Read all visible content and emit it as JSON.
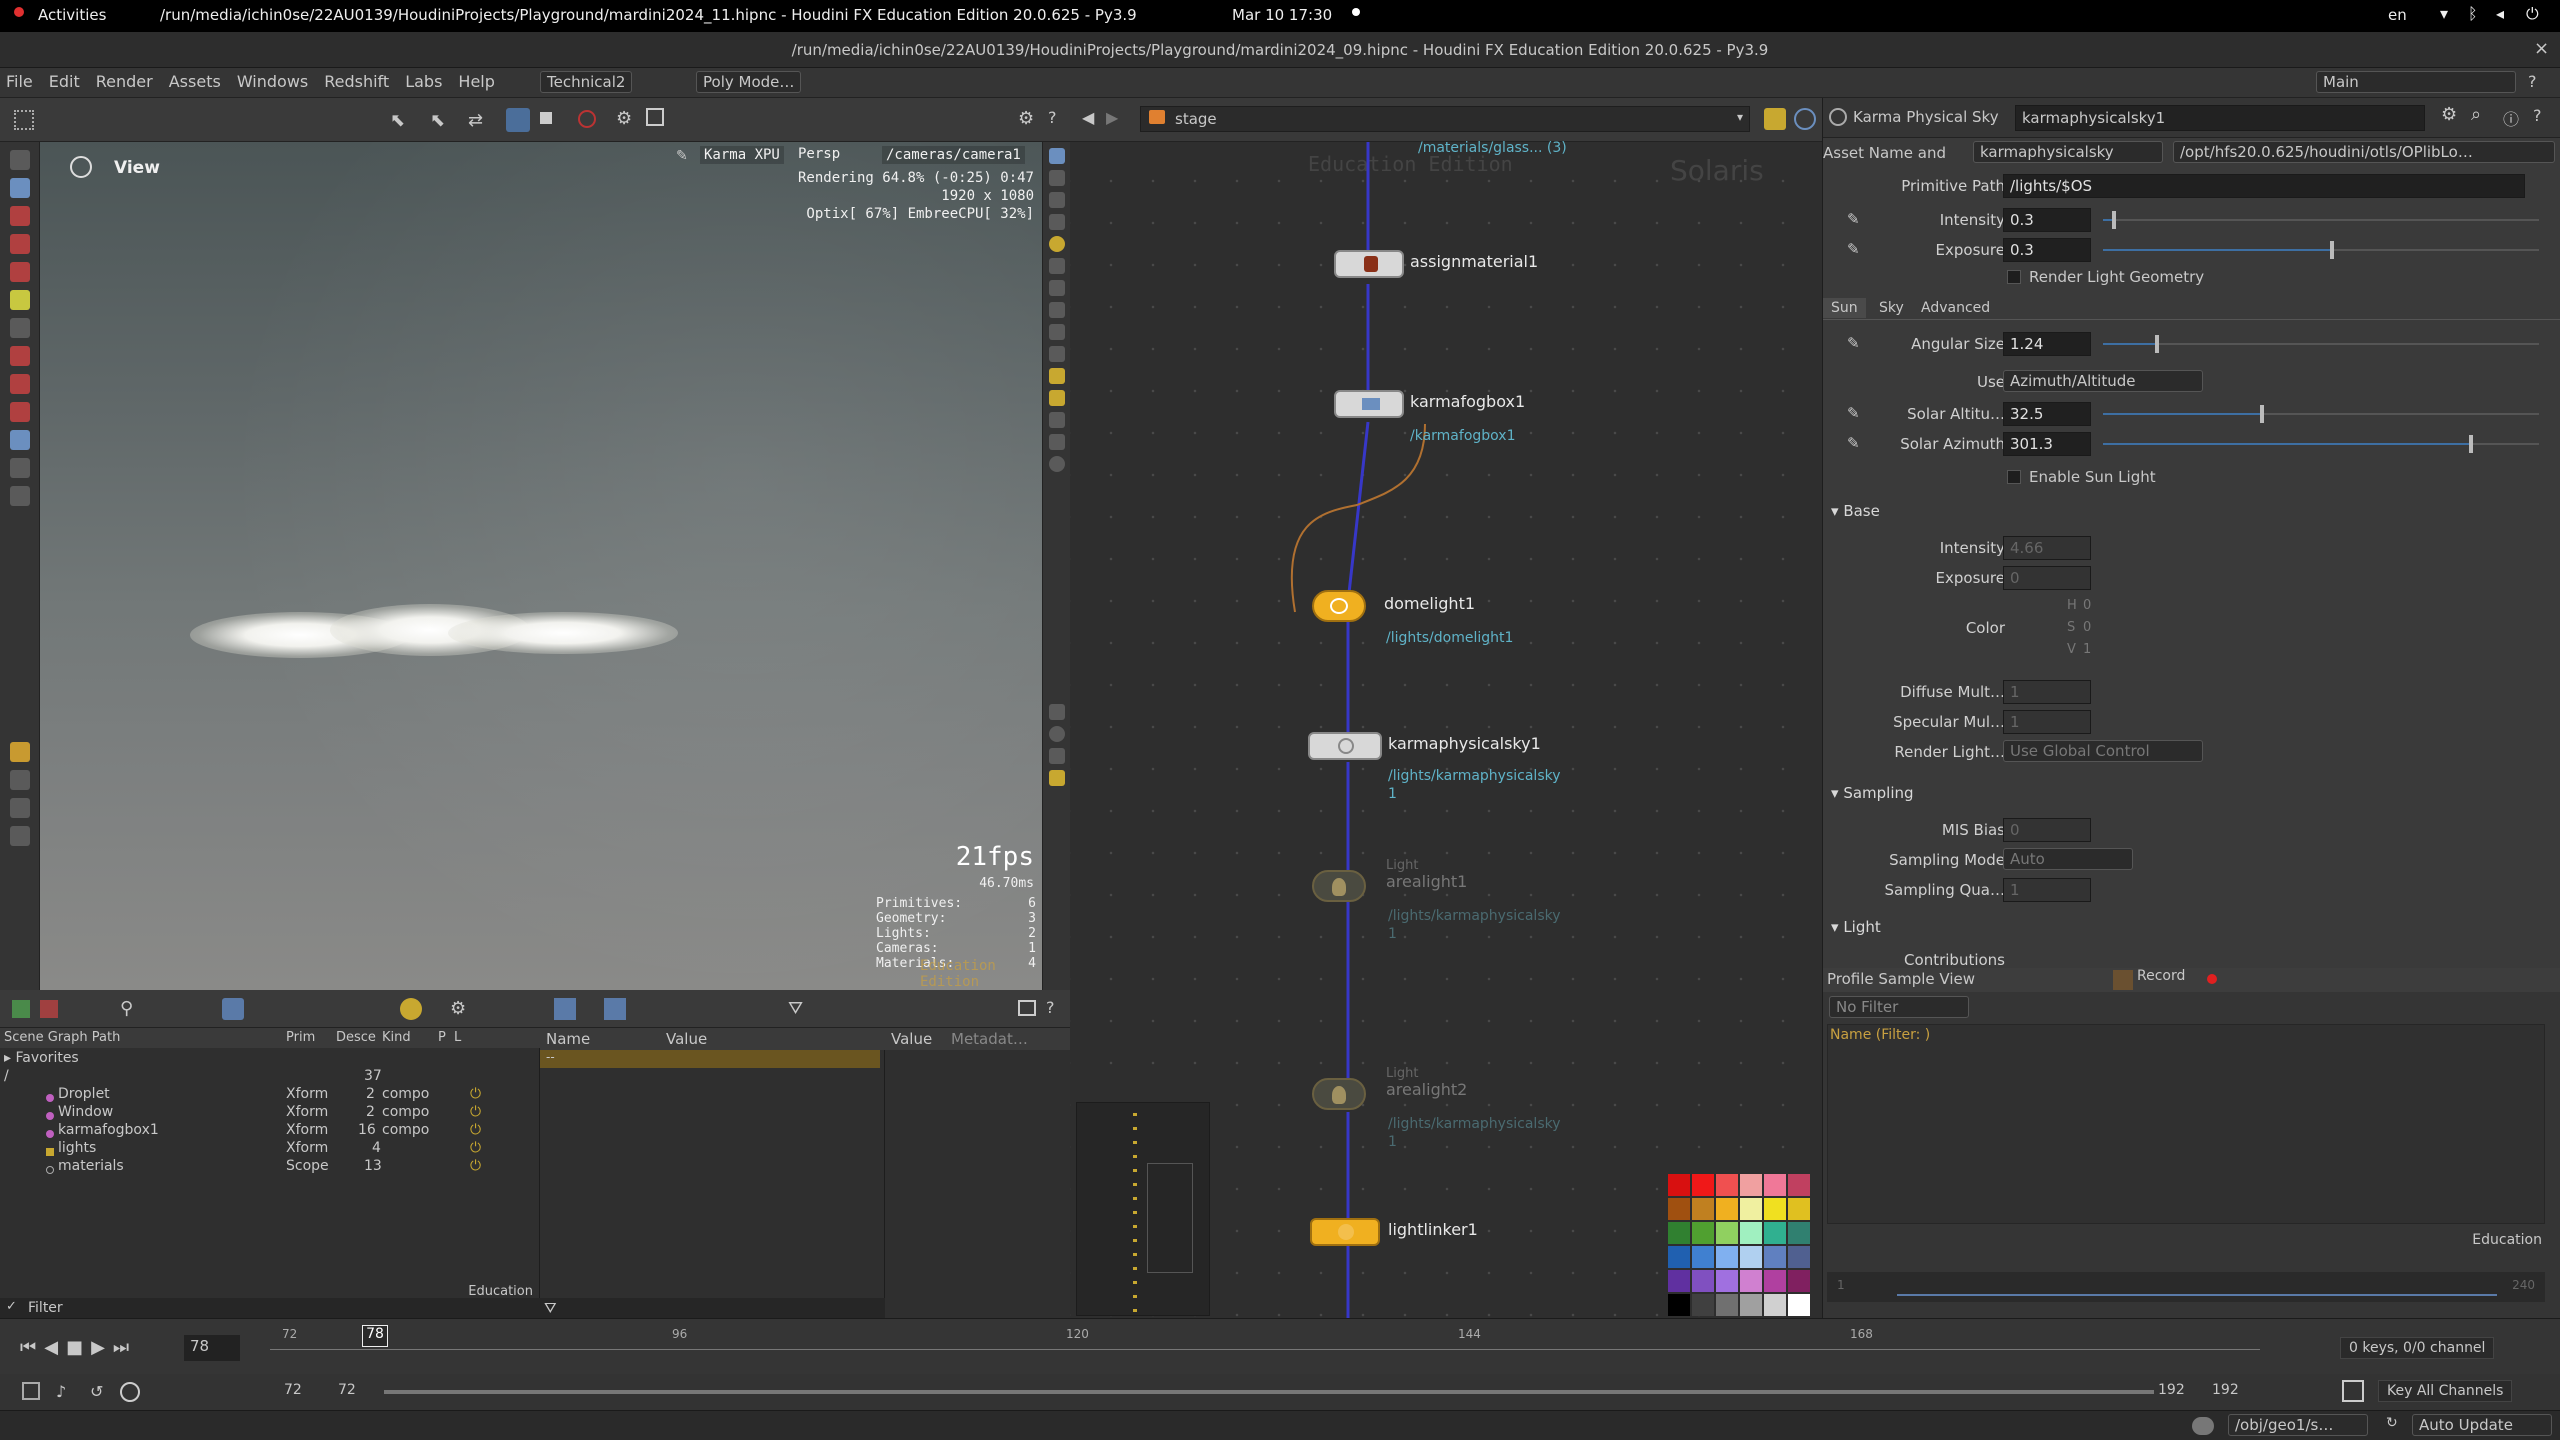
{
  "gnome": {
    "activities": "Activities",
    "window_title": "/run/media/ichin0se/22AU0139/HoudiniProjects/Playground/mardini2024_11.hipnc - Houdini FX Education Edition 20.0.625 - Py3.9",
    "clock": "Mar 10  17:30",
    "lang": "en"
  },
  "titlebar": {
    "title": "/run/media/ichin0se/22AU0139/HoudiniProjects/Playground/mardini2024_09.hipnc - Houdini FX Education Edition 20.0.625 - Py3.9",
    "close": "×"
  },
  "menubar": {
    "items": [
      "File",
      "Edit",
      "Render",
      "Assets",
      "Windows",
      "Redshift",
      "Labs",
      "Help"
    ],
    "desktop": "Technical2",
    "poly_mode": "Poly Mode…",
    "main": "Main"
  },
  "viewport": {
    "title": "View",
    "renderer": "Karma XPU",
    "persp": "Persp",
    "camera": "/cameras/camera1",
    "status_line1": "Rendering  64.8%  (-0:25)  0:47",
    "status_line2": "1920 x 1080",
    "status_line3": "Optix[ 67%] EmbreeCPU[ 32%]",
    "fps": "21fps",
    "ms": "46.70ms",
    "stats": [
      {
        "label": "Primitives:",
        "value": "6"
      },
      {
        "label": "Geometry:",
        "value": "3"
      },
      {
        "label": "Lights:",
        "value": "2"
      },
      {
        "label": "Cameras:",
        "value": "1"
      },
      {
        "label": "Materials:",
        "value": "4"
      }
    ],
    "watermark": "Education Edition"
  },
  "network": {
    "path": "stage",
    "watermark1": "Education Edition",
    "watermark2": "Solaris",
    "nodes": [
      {
        "name": "",
        "sub": "/materials/glass... (3)"
      },
      {
        "name": "assignmaterial1",
        "sub": ""
      },
      {
        "name": "karmafogbox1",
        "sub": "/karmafogbox1"
      },
      {
        "name": "domelight1",
        "sub": "/lights/domelight1"
      },
      {
        "name": "karmaphysicalsky1",
        "sub": "/lights/karmaphysicalsky",
        "sub2": "1"
      },
      {
        "name": "arealight1",
        "pre": "Light",
        "sub": "/lights/karmaphysicalsky",
        "sub2": "1"
      },
      {
        "name": "arealight2",
        "pre": "Light",
        "sub": "/lights/karmaphysicalsky",
        "sub2": "1"
      },
      {
        "name": "lightlinker1",
        "sub": ""
      }
    ]
  },
  "params": {
    "node_type": "Karma Physical Sky",
    "node_name": "karmaphysicalsky1",
    "asset_label": "Asset Name and",
    "asset_name": "karmaphysicalsky",
    "asset_path": "/opt/hfs20.0.625/houdini/otls/OPlibLo…",
    "primitive_path_label": "Primitive Path",
    "primitive_path": "/lights/$OS",
    "intensity_label": "Intensity",
    "intensity": "0.3",
    "intensity_frac": 0.02,
    "exposure_label": "Exposure",
    "exposure": "0.3",
    "exposure_frac": 0.52,
    "render_geo": "Render Light Geometry",
    "tabs": [
      "Sun",
      "Sky",
      "Advanced"
    ],
    "angular_label": "Angular Size",
    "angular": "1.24",
    "angular_frac": 0.12,
    "use_label": "Use",
    "use_value": "Azimuth/Altitude",
    "alt_label": "Solar Altitu…",
    "alt": "32.5",
    "alt_frac": 0.36,
    "az_label": "Solar Azimuth",
    "az": "301.3",
    "az_frac": 0.84,
    "enable_sun": "Enable Sun Light",
    "base": "Base",
    "b_intensity": "Intensity",
    "b_intensity_v": "4.66",
    "b_exposure": "Exposure",
    "b_exposure_v": "0",
    "color": "Color",
    "h": "H",
    "s": "S",
    "v": "V",
    "hv": "0",
    "sv": "0",
    "vv": "1",
    "diffuse": "Diffuse Mult…",
    "diffuse_v": "1",
    "specular": "Specular Mul…",
    "specular_v": "1",
    "render_light": "Render Light…",
    "render_light_v": "Use Global Control",
    "sampling": "Sampling",
    "mis": "MIS Bias",
    "mis_v": "0",
    "smode": "Sampling Mode",
    "smode_v": "Auto",
    "squal": "Sampling Qua…",
    "squal_v": "1",
    "light": "Light",
    "contrib": "Contributions"
  },
  "profile": {
    "title": "Profile Sample View",
    "record": "Record",
    "filter": "No Filter",
    "header": "Name  (Filter: )",
    "edu": "Education",
    "range_lo": "1",
    "range_hi": "240"
  },
  "scenegraph": {
    "header": [
      "Scene Graph Path",
      "Prim",
      "Desce",
      "Kind",
      "P",
      "L"
    ],
    "favorites": "Favorites",
    "root": "/",
    "root_count": "37",
    "rows": [
      {
        "name": "Droplet",
        "type": "Xform",
        "count": "2",
        "kind": "compo"
      },
      {
        "name": "Window",
        "type": "Xform",
        "count": "2",
        "kind": "compo"
      },
      {
        "name": "karmafogbox1",
        "type": "Xform",
        "count": "16",
        "kind": "compo"
      },
      {
        "name": "lights",
        "type": "Xform",
        "count": "4",
        "kind": ""
      },
      {
        "name": "materials",
        "type": "Scope",
        "count": "13",
        "kind": ""
      }
    ],
    "filter": "Filter",
    "edu": "Education"
  },
  "namepanel": {
    "name": "Name",
    "value": "Value",
    "row": "--"
  },
  "valuepanel": {
    "value": "Value",
    "meta": "Metadat…"
  },
  "timeline": {
    "frame": "78",
    "ticks": [
      "72",
      "96",
      "120",
      "144",
      "168"
    ],
    "current": "78",
    "start": "72",
    "start2": "72",
    "end": "192",
    "end2": "192",
    "keys": "0 keys, 0/0 channel",
    "key_all": "Key All Channels"
  },
  "status": {
    "path": "/obj/geo1/s…",
    "auto": "Auto Update"
  },
  "colors": {
    "accent": "#3d6fa3",
    "node_link": "#5fb3c8",
    "wire": "#3737c8",
    "timeline_marker": "#f0f0f0"
  }
}
